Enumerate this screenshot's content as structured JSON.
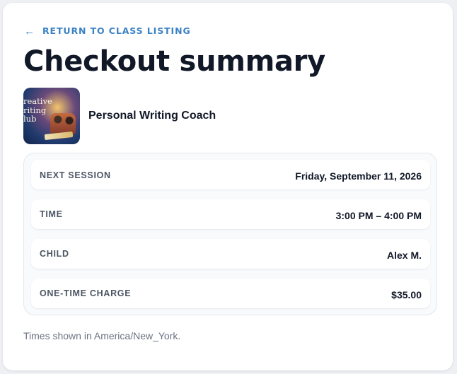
{
  "nav": {
    "back_icon": "left-arrow-icon",
    "back_arrow_glyph": "←",
    "back_label": "RETURN TO CLASS LISTING"
  },
  "page": {
    "title": "Checkout summary"
  },
  "product": {
    "name": "Personal Writing Coach",
    "thumbnail_text": "reative\nriting\nlub"
  },
  "details": [
    {
      "label": "NEXT SESSION",
      "value": "Friday, September 11, 2026"
    },
    {
      "label": "TIME",
      "value": "3:00 PM – 4:00 PM"
    },
    {
      "label": "CHILD",
      "value": "Alex M."
    },
    {
      "label": "ONE-TIME CHARGE",
      "value": "$35.00"
    }
  ],
  "footer": {
    "timezone_note": "Times shown in America/New_York."
  },
  "colors": {
    "accent": "#3b82c4",
    "title": "#111827",
    "muted": "#6b7280"
  }
}
